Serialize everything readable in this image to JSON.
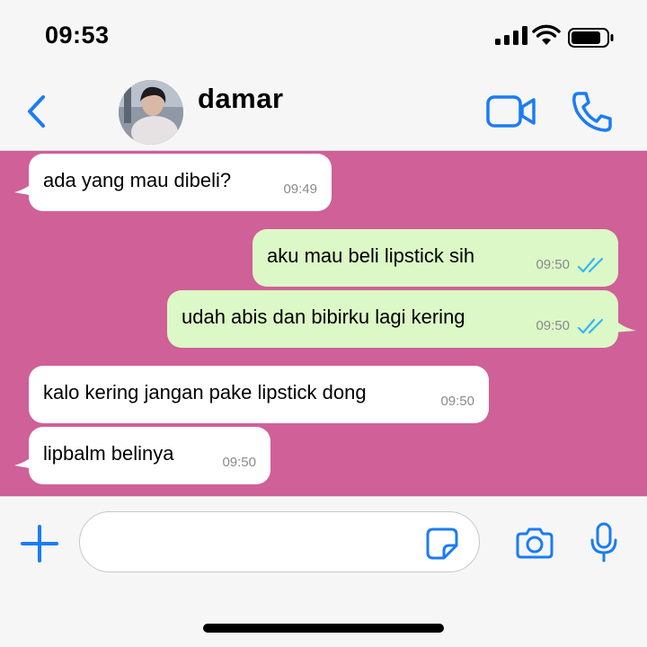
{
  "status_bar": {
    "time": "09:53"
  },
  "header": {
    "contact_name": "damar"
  },
  "messages": [
    {
      "direction": "in",
      "text": "ada yang mau dibeli?",
      "time": "09:49"
    },
    {
      "direction": "out",
      "text": "aku mau beli lipstick sih",
      "time": "09:50",
      "status": "read"
    },
    {
      "direction": "out",
      "text": "udah abis dan bibirku lagi kering",
      "time": "09:50",
      "status": "read"
    },
    {
      "direction": "in",
      "text": "kalo kering jangan pake lipstick dong",
      "time": "09:50"
    },
    {
      "direction": "in",
      "text": "lipbalm belinya",
      "time": "09:50"
    }
  ],
  "input": {
    "value": "",
    "placeholder": ""
  },
  "icons": {
    "back": "chevron-left-icon",
    "video": "video-camera-icon",
    "call": "phone-icon",
    "plus": "plus-icon",
    "sticker": "sticker-icon",
    "camera": "camera-icon",
    "mic": "microphone-icon"
  },
  "colors": {
    "accent": "#1a7cf5",
    "chat_background": "#d06098",
    "incoming_bubble": "#ffffff",
    "outgoing_bubble": "#dcf8c6",
    "read_ticks": "#34b7f1"
  }
}
